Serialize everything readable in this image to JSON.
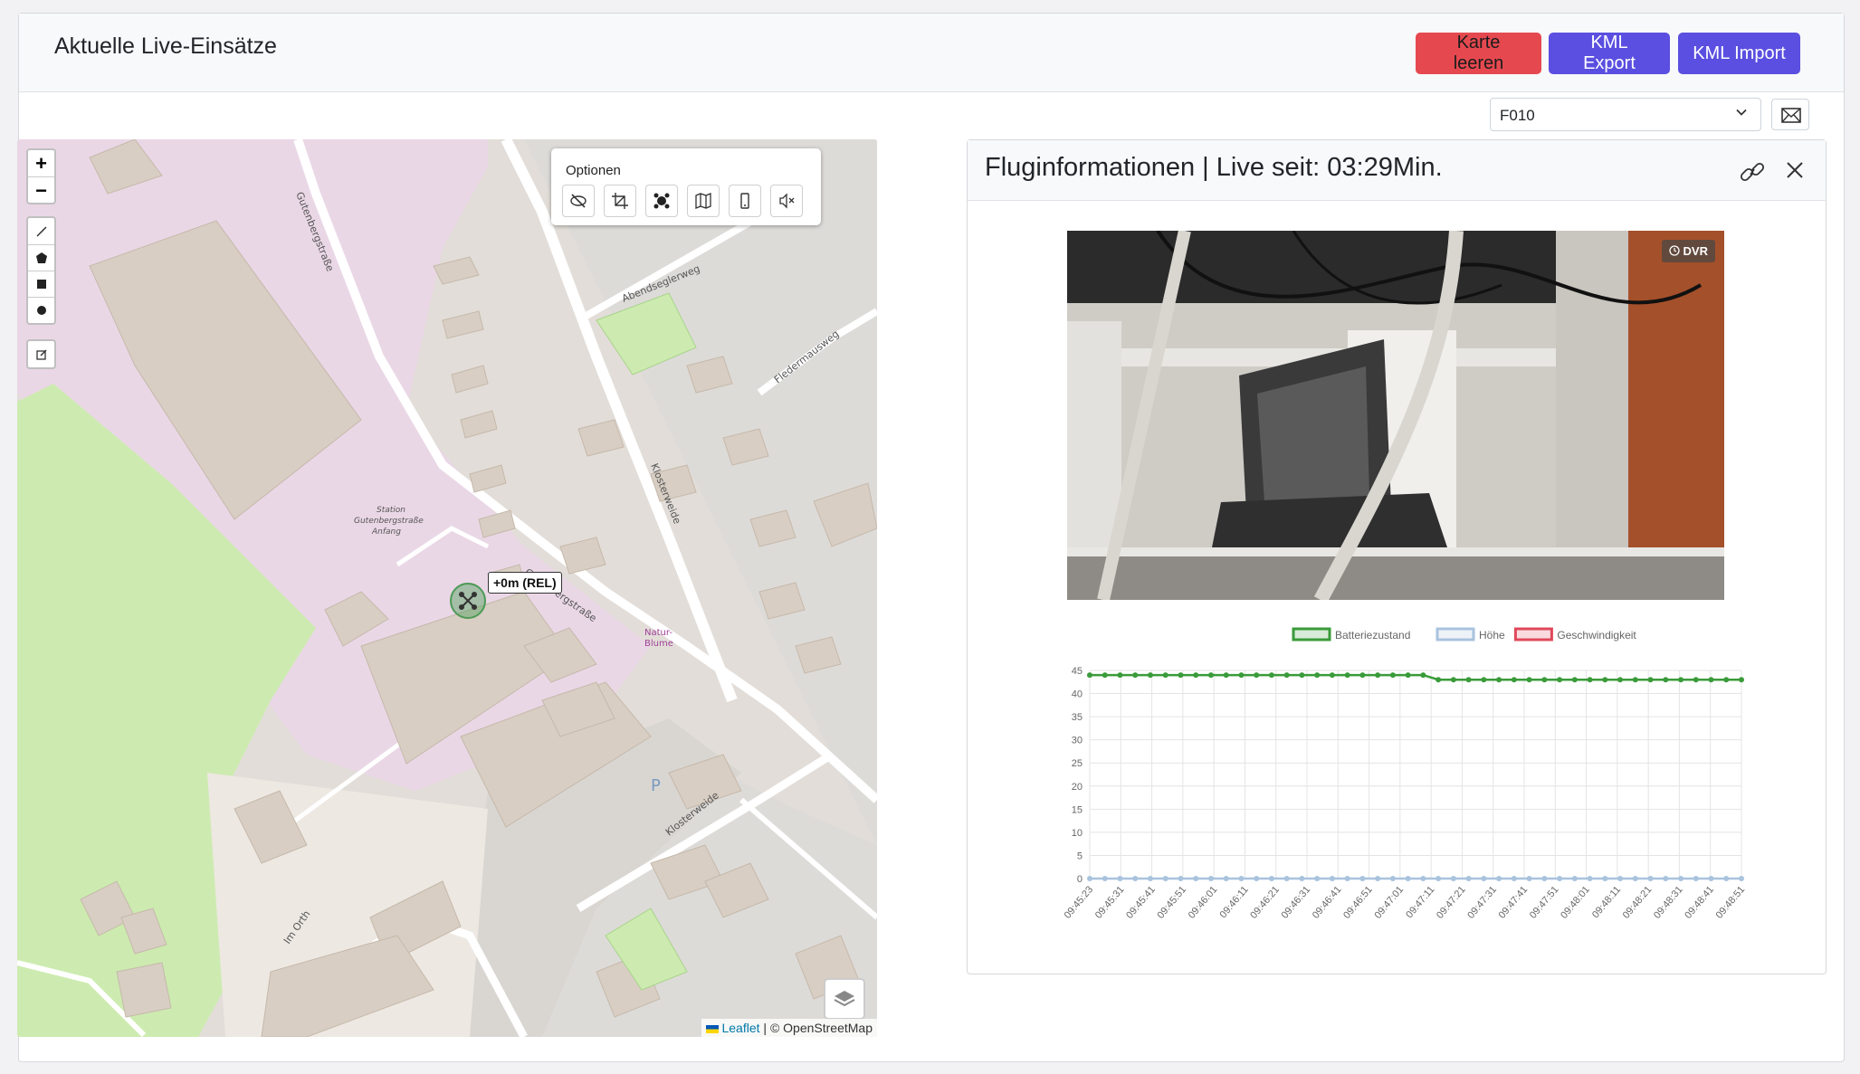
{
  "header": {
    "title": "Aktuelle Live-Einsätze",
    "buttons": {
      "clear": "Karte leeren",
      "kml_export": "KML Export",
      "kml_import": "KML Import"
    }
  },
  "selector": {
    "selected": "F010"
  },
  "map": {
    "options_title": "Optionen",
    "marker_label": "+0m (REL)",
    "attribution_link": "Leaflet",
    "attribution_text": "| © OpenStreetMap",
    "zoom_in": "+",
    "zoom_out": "−",
    "street_labels": [
      "Gutenbergstraße",
      "Abendseglerweg",
      "Fledermausweg",
      "Klosterweide",
      "Klosterweide",
      "Im Orth",
      "Gutenbergstraße"
    ],
    "station_label": [
      "Station",
      "Gutenbergstraße",
      "Anfang"
    ],
    "poi_label": [
      "Natur-",
      "Blume"
    ]
  },
  "flight": {
    "title": "Fluginformationen | Live seit: 03:29Min.",
    "video_badge": "DVR"
  },
  "chart_data": {
    "type": "line",
    "legend_position": "top",
    "series": [
      {
        "name": "Batteriezustand",
        "color": "#3a9b3a",
        "values": [
          44,
          44,
          44,
          44,
          44,
          44,
          44,
          44,
          44,
          44,
          44,
          44,
          44,
          44,
          44,
          44,
          44,
          44,
          44,
          44,
          44,
          44,
          44,
          43,
          43,
          43,
          43,
          43,
          43,
          43,
          43,
          43,
          43,
          43,
          43,
          43,
          43,
          43,
          43,
          43,
          43,
          43,
          43,
          43
        ]
      },
      {
        "name": "Höhe",
        "color": "#a9c3de",
        "values": [
          0,
          0,
          0,
          0,
          0,
          0,
          0,
          0,
          0,
          0,
          0,
          0,
          0,
          0,
          0,
          0,
          0,
          0,
          0,
          0,
          0,
          0,
          0,
          0,
          0,
          0,
          0,
          0,
          0,
          0,
          0,
          0,
          0,
          0,
          0,
          0,
          0,
          0,
          0,
          0,
          0,
          0,
          0,
          0
        ]
      },
      {
        "name": "Geschwindigkeit",
        "color": "#e0485a",
        "values": []
      }
    ],
    "x_tick_labels": [
      "09:45:23",
      "09:45:31",
      "09:45:41",
      "09:45:51",
      "09:46:01",
      "09:46:11",
      "09:46:21",
      "09:46:31",
      "09:46:41",
      "09:46:51",
      "09:47:01",
      "09:47:11",
      "09:47:21",
      "09:47:31",
      "09:47:41",
      "09:47:51",
      "09:48:01",
      "09:48:11",
      "09:48:21",
      "09:48:31",
      "09:48:41",
      "09:48:51"
    ],
    "y_ticks": [
      0,
      5,
      10,
      15,
      20,
      25,
      30,
      35,
      40,
      45
    ],
    "ylim": [
      0,
      45
    ],
    "grid": true
  }
}
